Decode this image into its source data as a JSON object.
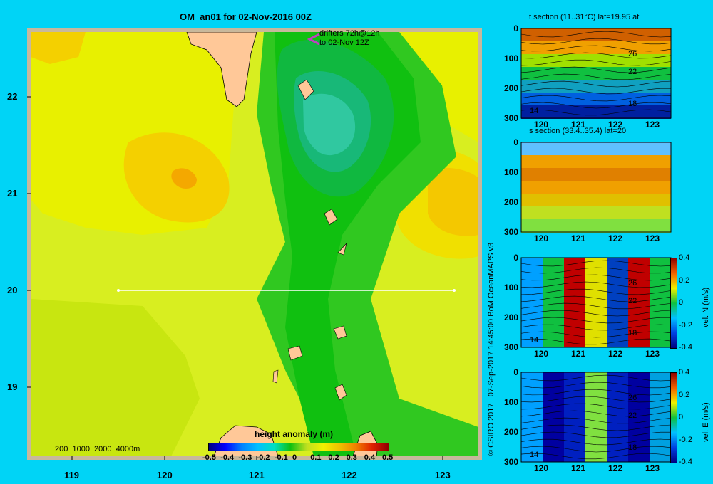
{
  "map": {
    "title": "OM_an01 for 02-Nov-2016 00Z",
    "drifters_line1": "drifters 72h@12h",
    "drifters_line2": "to 02-Nov 12Z",
    "depth_legend": "200  1000  2000  4000m",
    "lon_ticks": [
      "119",
      "120",
      "121",
      "122",
      "123"
    ],
    "lat_ticks": [
      "22",
      "21",
      "20",
      "19"
    ],
    "colorbar_title": "height anomaly (m)",
    "colorbar_ticks": [
      "-0.5",
      "-0.4",
      "-0.3",
      "-0.2",
      "-0.1",
      "0",
      "0.1",
      "0.2",
      "0.3",
      "0.4",
      "0.5"
    ]
  },
  "credit": "© CSIRO 2017   07-Sep-2017 14:45:00 BoM OceanMAPS v3",
  "sections": [
    {
      "title": "t section (11..31°C) lat=19.95 at",
      "depth_ticks": [
        "0",
        "100",
        "200",
        "300"
      ],
      "lon_ticks": [
        "120",
        "121",
        "122",
        "123"
      ],
      "contour_labels": [
        "26",
        "22",
        "18",
        "14"
      ],
      "colorbar_label": "",
      "colorbar_ticks": []
    },
    {
      "title": "s section (33.4..35.4) lat=20",
      "depth_ticks": [
        "0",
        "100",
        "200",
        "300"
      ],
      "lon_ticks": [
        "120",
        "121",
        "122",
        "123"
      ],
      "contour_labels": [],
      "colorbar_label": "",
      "colorbar_ticks": []
    },
    {
      "title": "",
      "depth_ticks": [
        "0",
        "100",
        "200",
        "300"
      ],
      "lon_ticks": [
        "120",
        "121",
        "122",
        "123"
      ],
      "contour_labels": [
        "26",
        "22",
        "18",
        "14"
      ],
      "colorbar_label": "vel. N (m/s)",
      "colorbar_ticks": [
        "0.4",
        "0.2",
        "0",
        "-0.2",
        "-0.4"
      ]
    },
    {
      "title": "",
      "depth_ticks": [
        "0",
        "100",
        "200",
        "300"
      ],
      "lon_ticks": [
        "120",
        "121",
        "122",
        "123"
      ],
      "contour_labels": [
        "26",
        "22",
        "18",
        "14"
      ],
      "colorbar_label": "vel. E (m/s)",
      "colorbar_ticks": [
        "0.4",
        "0.2",
        "0",
        "-0.2",
        "-0.4"
      ]
    }
  ]
}
